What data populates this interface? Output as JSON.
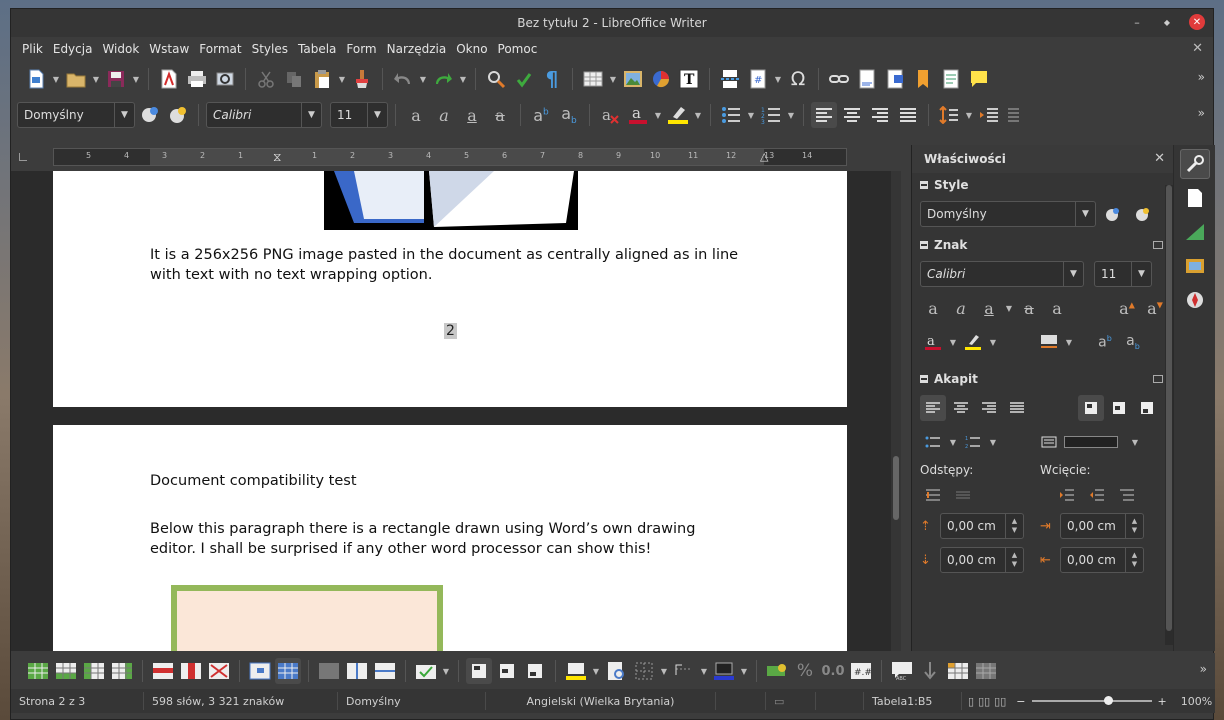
{
  "window": {
    "title": "Bez tytułu 2 - LibreOffice Writer",
    "controls": {
      "minimize": "–",
      "maximize": "◆",
      "close": "✕"
    }
  },
  "menu": {
    "items": [
      "Plik",
      "Edycja",
      "Widok",
      "Wstaw",
      "Format",
      "Styles",
      "Tabela",
      "Form",
      "Narzędzia",
      "Okno",
      "Pomoc"
    ],
    "close_doc": "✕"
  },
  "formatting": {
    "paragraph_style": "Domyślny",
    "font_name": "Calibri",
    "font_size": "11"
  },
  "ruler": {
    "left_numbers": [
      "5",
      "4",
      "3",
      "2",
      "1"
    ],
    "right_numbers": [
      "1",
      "2",
      "3",
      "4",
      "5",
      "6",
      "7",
      "8",
      "9",
      "10",
      "11",
      "12",
      "13",
      "14"
    ]
  },
  "document": {
    "page1": {
      "paragraph": "It is a 256x256 PNG image pasted in the document as centrally aligned as in line with text with no text wrapping option.",
      "page_number": "2"
    },
    "page2": {
      "heading": "Document compatibility test",
      "paragraph": "Below this paragraph there is a rectangle drawn using Word’s own drawing editor. I shall be surprised if any other word processor can show this!"
    }
  },
  "sidebar": {
    "title": "Właściwości",
    "style_section": {
      "label": "Style",
      "value": "Domyślny"
    },
    "char_section": {
      "label": "Znak",
      "font": "Calibri",
      "size": "11"
    },
    "para_section": {
      "label": "Akapit",
      "spacing_label": "Odstępy:",
      "indent_label": "Wcięcie:",
      "above": "0,00 cm",
      "below": "0,00 cm",
      "before_text": "0,00 cm",
      "after_text": "0,00 cm"
    }
  },
  "statusbar": {
    "page": "Strona 2 z 3",
    "words": "598 słów, 3 321 znaków",
    "page_style": "Domyślny",
    "language": "Angielski (Wielka Brytania)",
    "table_cell": "Tabela1:B5",
    "zoom": "100%"
  },
  "colors": {
    "font_color": "#c8102e",
    "highlight": "#ffe600",
    "rectangle_fill": "#fbe7d8",
    "rectangle_border": "#94b85a"
  }
}
